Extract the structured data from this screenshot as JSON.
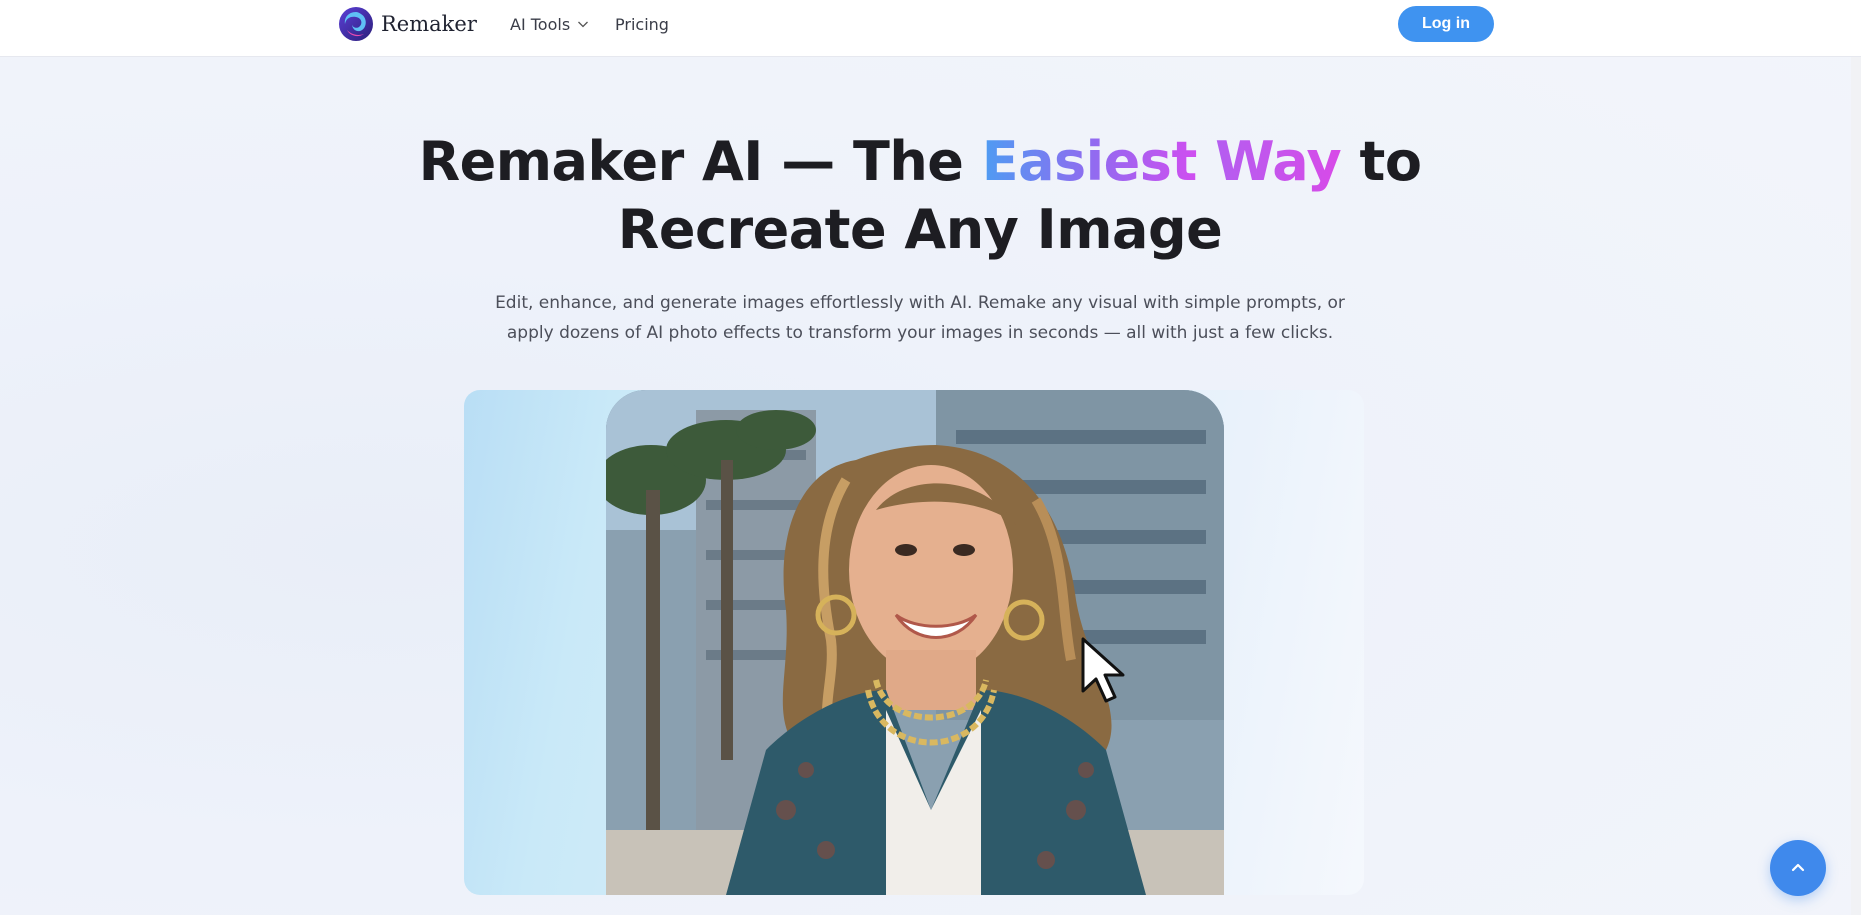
{
  "header": {
    "brand": "Remaker",
    "nav": [
      {
        "label": "AI Tools",
        "has_dropdown": true
      },
      {
        "label": "Pricing",
        "has_dropdown": false
      }
    ],
    "login_label": "Log in"
  },
  "hero": {
    "title_part1": "Remaker AI — The ",
    "title_highlight_1": "Easiest",
    "title_highlight_2": "Way",
    "title_part2": " to",
    "title_line2": "Recreate Any Image",
    "subtitle_line1": "Edit, enhance, and generate images effortlessly with AI. Remake any visual with simple prompts, or",
    "subtitle_line2": "apply dozens of AI photo effects to transform your images in seconds — all with just a few clicks."
  },
  "colors": {
    "accent": "#3f93f0",
    "gradient_start": "#4e9cf2",
    "gradient_end": "#d04ef0"
  },
  "icons": {
    "logo": "remaker-swirl-logo",
    "dropdown": "chevron-down-icon",
    "cursor": "mouse-pointer-icon",
    "scroll_top": "chevron-up-icon"
  }
}
